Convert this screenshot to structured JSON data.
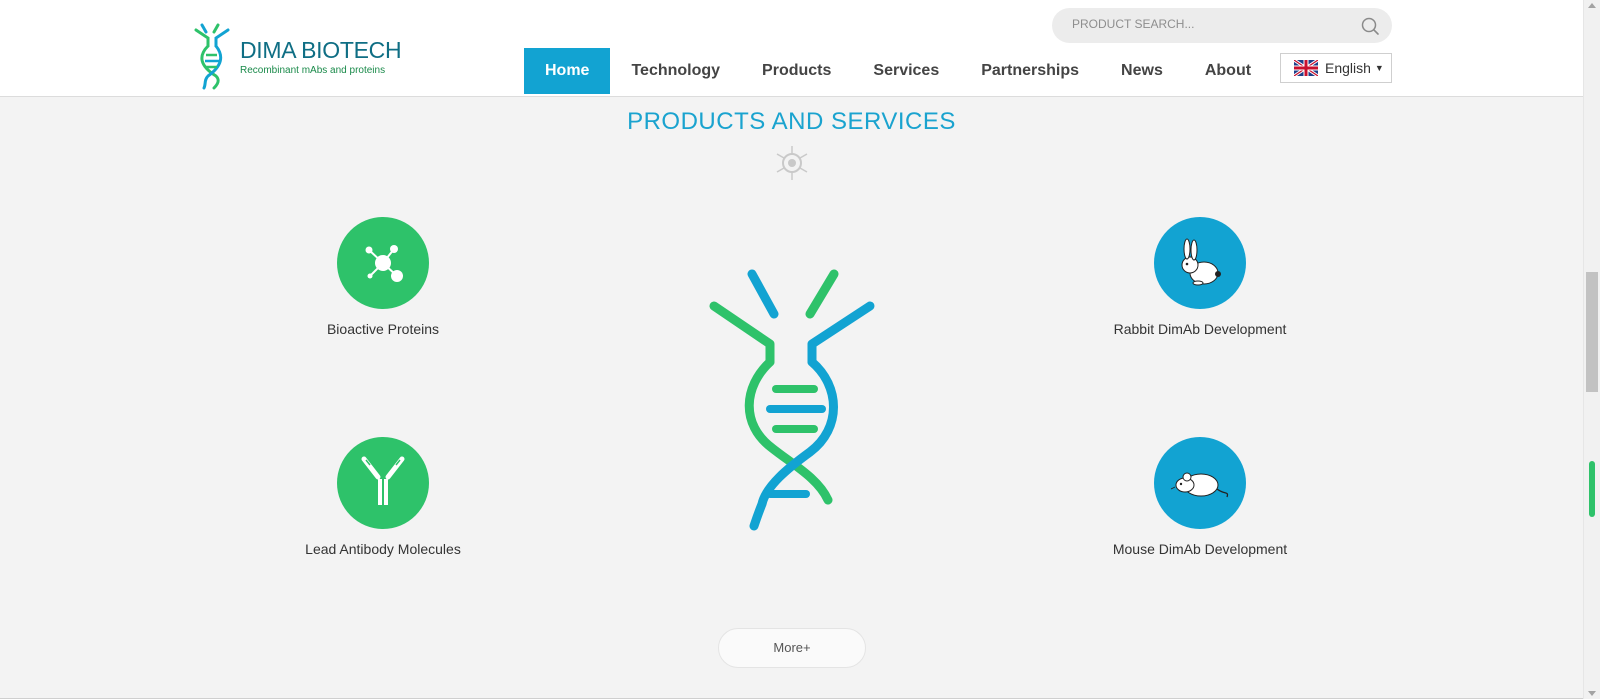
{
  "brand": {
    "name": "DIMA BIOTECH",
    "tagline": "Recombinant mAbs and proteins",
    "green": "#2ec26a",
    "blue": "#12a3d2"
  },
  "search": {
    "placeholder": "PRODUCT SEARCH...",
    "icon": "search-icon"
  },
  "nav": {
    "items": [
      {
        "label": "Home",
        "active": true
      },
      {
        "label": "Technology"
      },
      {
        "label": "Products"
      },
      {
        "label": "Services"
      },
      {
        "label": "Partnerships"
      },
      {
        "label": "News"
      },
      {
        "label": "About"
      }
    ]
  },
  "language": {
    "label": "English",
    "icon": "uk-flag-icon"
  },
  "section": {
    "title": "PRODUCTS AND SERVICES"
  },
  "services": [
    {
      "label": "Bioactive Proteins",
      "icon": "molecule-icon",
      "color": "green"
    },
    {
      "label": "Rabbit DimAb Development",
      "icon": "rabbit-icon",
      "color": "blue"
    },
    {
      "label": "Lead Antibody Molecules",
      "icon": "antibody-icon",
      "color": "green"
    },
    {
      "label": "Mouse DimAb Development",
      "icon": "mouse-icon",
      "color": "blue"
    }
  ],
  "more": {
    "label": "More+"
  }
}
